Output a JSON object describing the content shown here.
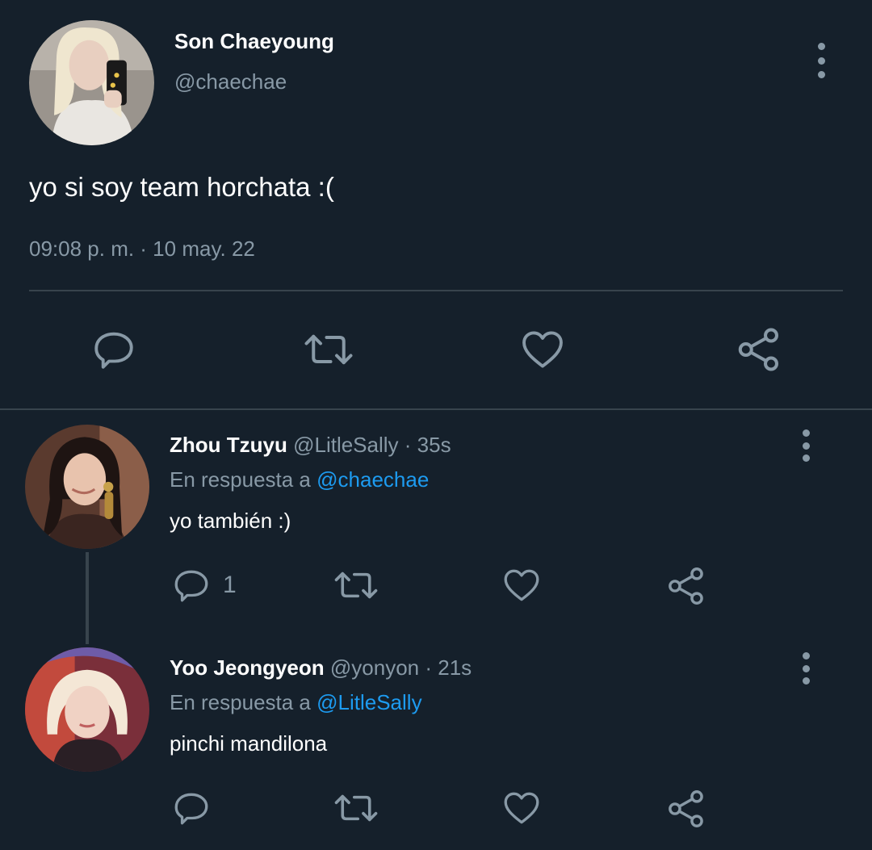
{
  "main_tweet": {
    "name": "Son Chaeyoung",
    "handle": "@chaechae",
    "text": "yo si soy team horchata :(",
    "timestamp": "09:08 p. m. · 10 may. 22",
    "avatar_icon": "avatar-photo"
  },
  "actions": {
    "reply_icon": "reply-icon",
    "retweet_icon": "retweet-icon",
    "like_icon": "heart-icon",
    "share_icon": "share-icon"
  },
  "replies": [
    {
      "name": "Zhou Tzuyu",
      "handle_time": "@LitleSally · 35s",
      "reply_prefix": "En respuesta a",
      "reply_to": "@chaechae",
      "text": "yo también :)",
      "reply_count": "1"
    },
    {
      "name": "Yoo Jeongyeon",
      "handle_time": "@yonyon · 21s",
      "reply_prefix": "En respuesta a",
      "reply_to": "@LitleSally",
      "text": "pinchi mandilona",
      "reply_count": ""
    }
  ],
  "colors": {
    "background": "#15202b",
    "muted": "#8899a6",
    "link": "#1d9bf0",
    "divider": "#38444d"
  }
}
